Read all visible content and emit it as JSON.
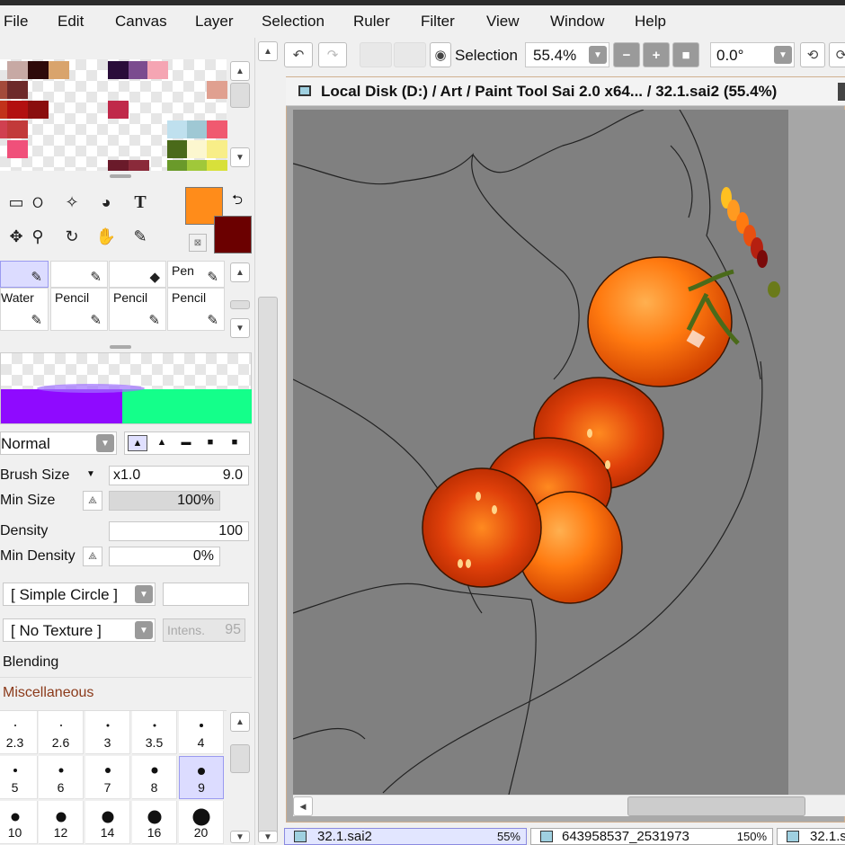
{
  "menu": [
    "File",
    "Edit",
    "Canvas",
    "Layer",
    "Selection",
    "Ruler",
    "Filter",
    "View",
    "Window",
    "Help"
  ],
  "toolbar": {
    "selection_label": "Selection",
    "zoom_value": "55.4%",
    "rotation_value": "0.0°"
  },
  "canvas_window": {
    "title": "Local Disk (D:) / Art / Paint Tool Sai 2.0 x64... / 32.1.sai2 (55.4%)"
  },
  "colors": {
    "foreground": "#ff8c1a",
    "background": "#6b0000",
    "accent_selected": "#c8c8ff"
  },
  "tools": [
    "rect-select-icon",
    "lasso-icon",
    "magic-wand-icon",
    "shape-fill-icon",
    "text-tool-icon",
    "move-icon",
    "zoom-icon",
    "rotate-icon",
    "hand-icon",
    "eyedropper-icon"
  ],
  "brush_tiles": {
    "row1": [
      "",
      "",
      "",
      "Pen"
    ],
    "row2": [
      "Water",
      "Pencil",
      "Pencil",
      "Pencil"
    ]
  },
  "brush_settings": {
    "blend_mode": "Normal",
    "brush_size_label": "Brush Size",
    "brush_size_multiplier": "x1.0",
    "brush_size_value": "9.0",
    "min_size_label": "Min Size",
    "min_size_value": "100%",
    "density_label": "Density",
    "density_value": "100",
    "min_density_label": "Min Density",
    "min_density_value": "0%",
    "shape": "[ Simple Circle ]",
    "texture": "[ No Texture ]",
    "intensity_label": "Intens.",
    "intensity_value": "95",
    "blending_label": "Blending",
    "misc_label": "Miscellaneous"
  },
  "brush_sizes": [
    "2.3",
    "2.6",
    "3",
    "3.5",
    "4",
    "5",
    "6",
    "7",
    "8",
    "9",
    "10",
    "12",
    "14",
    "16",
    "20"
  ],
  "status_tabs": [
    {
      "name": "32.1.sai2",
      "zoom": "55%"
    },
    {
      "name": "643958537_2531973",
      "zoom": "150%"
    },
    {
      "name": "32.1.s",
      "zoom": ""
    }
  ]
}
